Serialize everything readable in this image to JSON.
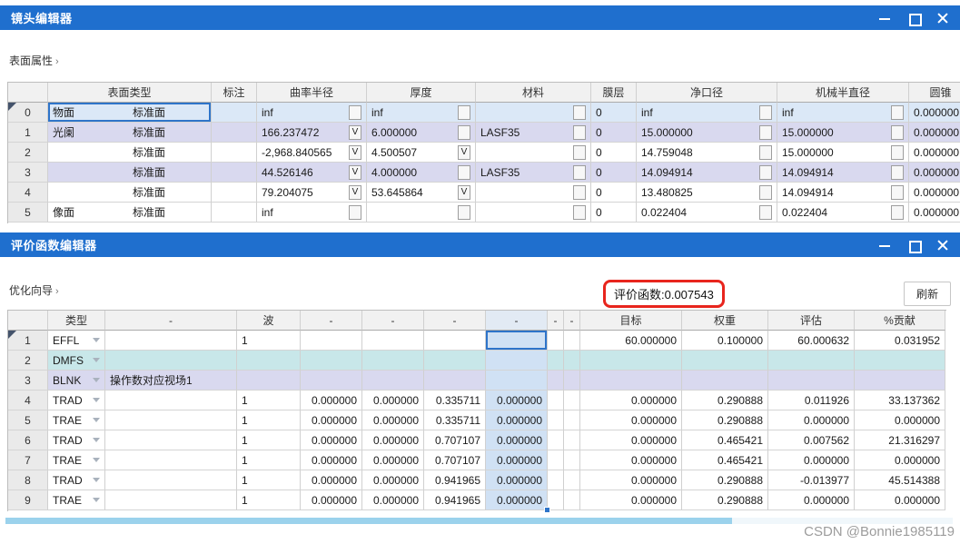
{
  "colors": {
    "titlebar_blue": "#1f6fce",
    "annotation_red": "#e8251d",
    "selected_row_blue": "#dbe8f7",
    "glass_row_lavender": "#d9d9ef",
    "dmfs_row_cyan": "#c8e7e9",
    "selected_column_blue": "#d0e1f4",
    "active_cell_border": "#2e74c9",
    "scrollbar_thumb": "#9bd2ec"
  },
  "icons": {
    "minimize": "—",
    "maximize": "▢",
    "close": "✕",
    "row_marker": "◤",
    "dropdown": "▼"
  },
  "lens_editor": {
    "title": "镜头编辑器",
    "section_label": "表面属性",
    "columns": [
      "",
      "表面类型",
      "标注",
      "曲率半径",
      "厚度",
      "材料",
      "膜层",
      "净口径",
      "机械半直径",
      "圆锥"
    ],
    "rows": [
      {
        "num": "0",
        "tag": "物面",
        "type": "标准面",
        "comment": "",
        "radius": "inf",
        "radius_solve": "",
        "thickness": "inf",
        "thickness_solve": "",
        "material": "",
        "material_solve": "",
        "coating": "0",
        "clear": "inf",
        "clear_solve": "",
        "mech": "inf",
        "mech_solve": "",
        "conic": "0.000000",
        "shade": "sel",
        "selected": true
      },
      {
        "num": "1",
        "tag": "光阑",
        "type": "标准面",
        "comment": "",
        "radius": "166.237472",
        "radius_solve": "V",
        "thickness": "6.000000",
        "thickness_solve": "",
        "material": "LASF35",
        "material_solve": "",
        "coating": "0",
        "clear": "15.000000",
        "clear_solve": "",
        "mech": "15.000000",
        "mech_solve": "",
        "conic": "0.000000",
        "shade": "lav",
        "selected": false
      },
      {
        "num": "2",
        "tag": "",
        "type": "标准面",
        "comment": "",
        "radius": "-2,968.840565",
        "radius_solve": "V",
        "thickness": "4.500507",
        "thickness_solve": "V",
        "material": "",
        "material_solve": "",
        "coating": "0",
        "clear": "14.759048",
        "clear_solve": "",
        "mech": "15.000000",
        "mech_solve": "",
        "conic": "0.000000",
        "shade": "",
        "selected": false
      },
      {
        "num": "3",
        "tag": "",
        "type": "标准面",
        "comment": "",
        "radius": "44.526146",
        "radius_solve": "V",
        "thickness": "4.000000",
        "thickness_solve": "",
        "material": "LASF35",
        "material_solve": "",
        "coating": "0",
        "clear": "14.094914",
        "clear_solve": "",
        "mech": "14.094914",
        "mech_solve": "",
        "conic": "0.000000",
        "shade": "lav",
        "selected": false
      },
      {
        "num": "4",
        "tag": "",
        "type": "标准面",
        "comment": "",
        "radius": "79.204075",
        "radius_solve": "V",
        "thickness": "53.645864",
        "thickness_solve": "V",
        "material": "",
        "material_solve": "",
        "coating": "0",
        "clear": "13.480825",
        "clear_solve": "",
        "mech": "14.094914",
        "mech_solve": "",
        "conic": "0.000000",
        "shade": "",
        "selected": false
      },
      {
        "num": "5",
        "tag": "像面",
        "type": "标准面",
        "comment": "",
        "radius": "inf",
        "radius_solve": "",
        "thickness": "",
        "thickness_solve": "",
        "material": "",
        "material_solve": "",
        "coating": "0",
        "clear": "0.022404",
        "clear_solve": "",
        "mech": "0.022404",
        "mech_solve": "",
        "conic": "0.000000",
        "shade": "",
        "selected": false
      }
    ]
  },
  "merit_editor": {
    "title": "评价函数编辑器",
    "wizard_label": "优化向导",
    "merit_value": "评价函数:0.007543",
    "refresh_label": "刷新",
    "columns": [
      "",
      "类型",
      "-",
      "波",
      "-",
      "-",
      "-",
      "-",
      "-",
      "-",
      "目标",
      "权重",
      "评估",
      "%贡献"
    ],
    "rows": [
      {
        "num": "1",
        "type": "EFFL",
        "comment": "",
        "wave": "1",
        "p1": "",
        "p2": "",
        "p3": "",
        "p4": "",
        "n1": "",
        "n2": "",
        "target": "60.000000",
        "weight": "0.100000",
        "value": "60.000632",
        "contrib": "0.031952",
        "shade": "",
        "selected": true,
        "active_p4": true
      },
      {
        "num": "2",
        "type": "DMFS",
        "comment": "",
        "wave": "",
        "p1": "",
        "p2": "",
        "p3": "",
        "p4": "",
        "n1": "",
        "n2": "",
        "target": "",
        "weight": "",
        "value": "",
        "contrib": "",
        "shade": "cyan",
        "selected": false,
        "active_p4": false
      },
      {
        "num": "3",
        "type": "BLNK",
        "comment": "操作数对应视场1",
        "wave": "",
        "p1": "",
        "p2": "",
        "p3": "",
        "p4": "",
        "n1": "",
        "n2": "",
        "target": "",
        "weight": "",
        "value": "",
        "contrib": "",
        "shade": "lav",
        "selected": false,
        "active_p4": false
      },
      {
        "num": "4",
        "type": "TRAD",
        "comment": "",
        "wave": "1",
        "p1": "0.000000",
        "p2": "0.000000",
        "p3": "0.335711",
        "p4": "0.000000",
        "n1": "",
        "n2": "",
        "target": "0.000000",
        "weight": "0.290888",
        "value": "0.011926",
        "contrib": "33.137362",
        "shade": "",
        "selected": false,
        "active_p4": false
      },
      {
        "num": "5",
        "type": "TRAE",
        "comment": "",
        "wave": "1",
        "p1": "0.000000",
        "p2": "0.000000",
        "p3": "0.335711",
        "p4": "0.000000",
        "n1": "",
        "n2": "",
        "target": "0.000000",
        "weight": "0.290888",
        "value": "0.000000",
        "contrib": "0.000000",
        "shade": "",
        "selected": false,
        "active_p4": false
      },
      {
        "num": "6",
        "type": "TRAD",
        "comment": "",
        "wave": "1",
        "p1": "0.000000",
        "p2": "0.000000",
        "p3": "0.707107",
        "p4": "0.000000",
        "n1": "",
        "n2": "",
        "target": "0.000000",
        "weight": "0.465421",
        "value": "0.007562",
        "contrib": "21.316297",
        "shade": "",
        "selected": false,
        "active_p4": false
      },
      {
        "num": "7",
        "type": "TRAE",
        "comment": "",
        "wave": "1",
        "p1": "0.000000",
        "p2": "0.000000",
        "p3": "0.707107",
        "p4": "0.000000",
        "n1": "",
        "n2": "",
        "target": "0.000000",
        "weight": "0.465421",
        "value": "0.000000",
        "contrib": "0.000000",
        "shade": "",
        "selected": false,
        "active_p4": false
      },
      {
        "num": "8",
        "type": "TRAD",
        "comment": "",
        "wave": "1",
        "p1": "0.000000",
        "p2": "0.000000",
        "p3": "0.941965",
        "p4": "0.000000",
        "n1": "",
        "n2": "",
        "target": "0.000000",
        "weight": "0.290888",
        "value": "-0.013977",
        "contrib": "45.514388",
        "shade": "",
        "selected": false,
        "active_p4": false
      },
      {
        "num": "9",
        "type": "TRAE",
        "comment": "",
        "wave": "1",
        "p1": "0.000000",
        "p2": "0.000000",
        "p3": "0.941965",
        "p4": "0.000000",
        "n1": "",
        "n2": "",
        "target": "0.000000",
        "weight": "0.290888",
        "value": "0.000000",
        "contrib": "0.000000",
        "shade": "",
        "selected": false,
        "active_p4": false
      }
    ]
  },
  "watermark": "CSDN @Bonnie1985119"
}
